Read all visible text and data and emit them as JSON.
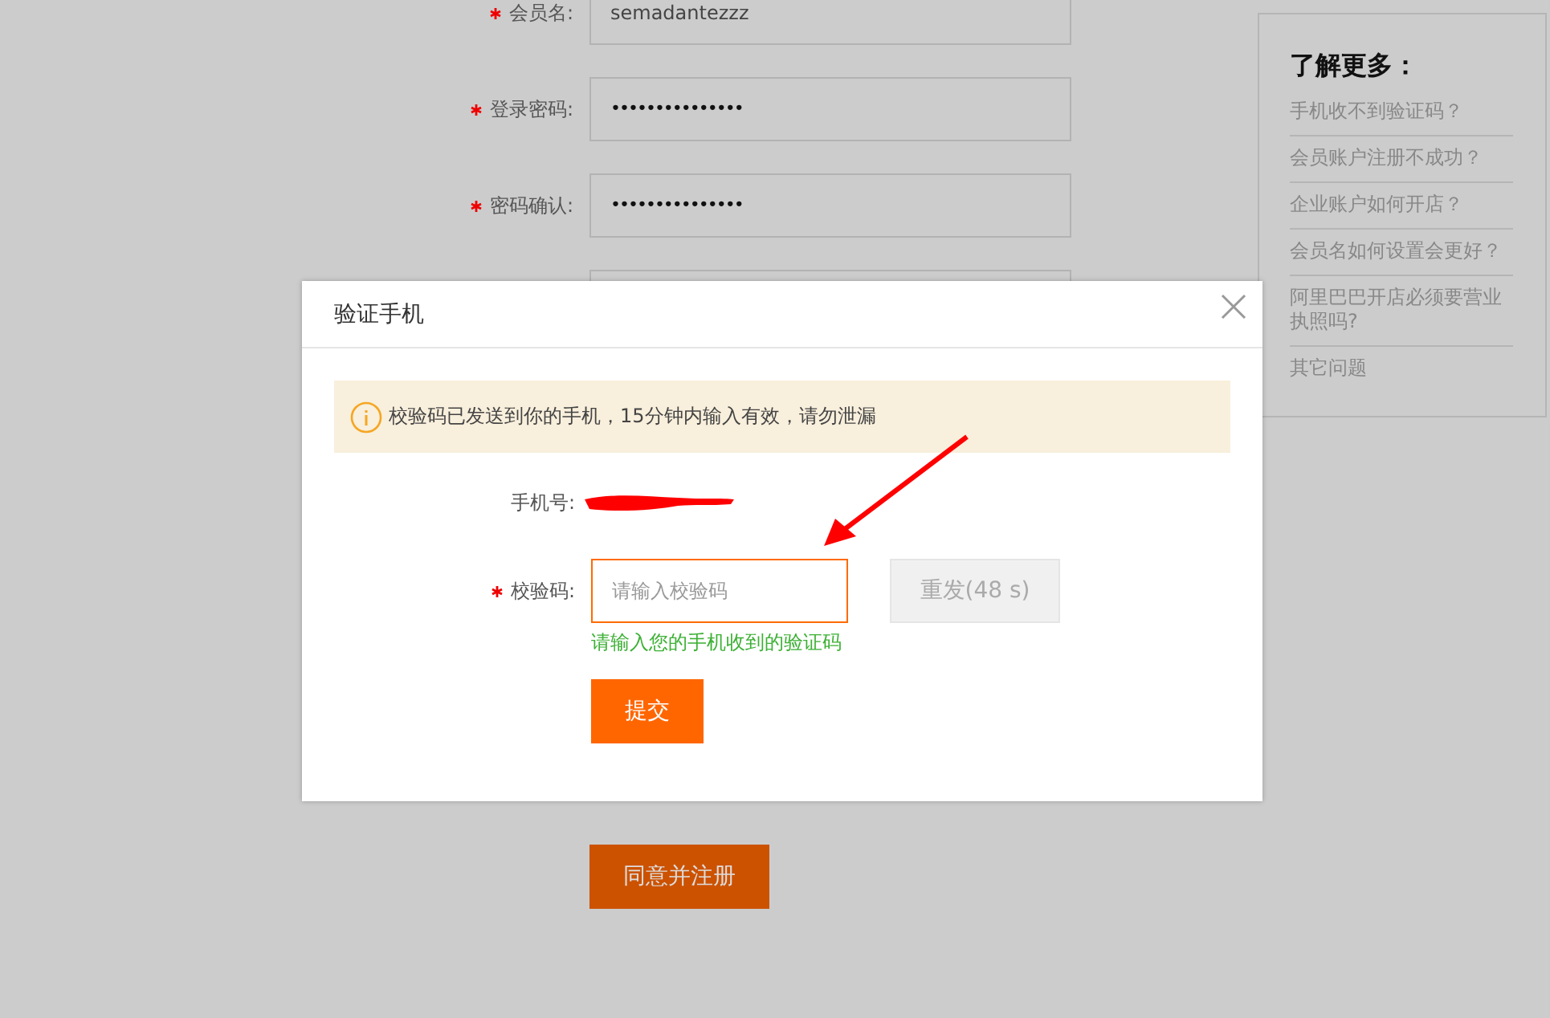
{
  "form": {
    "fields": [
      {
        "kind": "text",
        "label": "会员名:",
        "required": true,
        "value": "semadantezzz"
      },
      {
        "kind": "password",
        "label": "登录密码:",
        "required": true,
        "value": "•••••••••••••••"
      },
      {
        "kind": "password",
        "label": "密码确认:",
        "required": true,
        "value": "•••••••••••••••"
      },
      {
        "kind": "blank"
      }
    ],
    "agree_button": "同意并注册"
  },
  "help": {
    "title": "了解更多：",
    "links": [
      "手机收不到验证码？",
      "会员账户注册不成功？",
      "企业账户如何开店？",
      "会员名如何设置会更好？",
      "阿里巴巴开店必须要营业执照吗?",
      "其它问题"
    ]
  },
  "dialog": {
    "title": "验证手机",
    "notice": "校验码已发送到你的手机，15分钟内输入有效，请勿泄漏",
    "phone_label": "手机号:",
    "code_label": "校验码:",
    "code_required": true,
    "code_placeholder": "请输入校验码",
    "resend_button": "重发(48 s)",
    "hint": "请输入您的手机收到的验证码",
    "submit_button": "提交"
  }
}
